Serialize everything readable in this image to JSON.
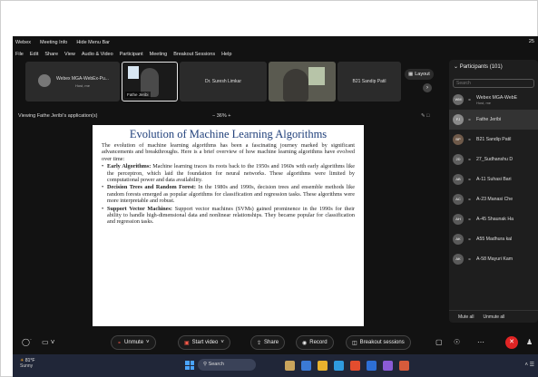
{
  "window": {
    "app_name": "Webex",
    "meeting_info": "Meeting Info",
    "hide_menu_bar": "Hide Menu Bar",
    "clock": "25"
  },
  "menu": [
    "File",
    "Edit",
    "Share",
    "View",
    "Audio & Video",
    "Participant",
    "Meeting",
    "Breakout Sessions",
    "Help"
  ],
  "strip": {
    "tile1_name": "Webex MGA-WebEx-Pu...",
    "tile1_sub": "Host, me",
    "tile2_name": "Fathe Jeribi",
    "tile3_name": "Dr. Suresh Limkar",
    "tile5_name": "B21 Sandip Patil",
    "layout_label": "Layout"
  },
  "share": {
    "viewing": "Viewing Fathe Jeribi's application(s)",
    "zoom": "36%"
  },
  "slide": {
    "title": "Evolution of Machine Learning Algorithms",
    "intro": "The evolution of machine learning algorithms has been a fascinating journey marked by significant advancements and breakthroughs. Here is a brief overview of how machine learning algorithms have evolved over time:",
    "bullets": [
      {
        "head": "Early Algorithms:",
        "text": " Machine learning traces its roots back to the 1950s and 1960s with early algorithms like the perceptron, which laid the foundation for neural networks. These algorithms were limited by computational power and data availability."
      },
      {
        "head": "Decision Trees and Random Forest:",
        "text": " In the 1980s and 1990s, decision trees and ensemble methods like random forests emerged as popular algorithms for classification and regression tasks. These algorithms were more interpretable and robust."
      },
      {
        "head": "Support Vector Machines:",
        "text": " Support vector machines (SVMs) gained prominence in the 1990s for their ability to handle high-dimensional data and nonlinear relationships. They became popular for classification and regression tasks."
      }
    ]
  },
  "participants": {
    "header": "Participants (101)",
    "search_placeholder": "Search",
    "list": [
      {
        "initials": "WM",
        "name": "Webex MGA-WebE",
        "sub": "Host, me",
        "color": "#6b6b6b"
      },
      {
        "initials": "FJ",
        "name": "Fathe Jeribi",
        "sub": "",
        "color": "#8a8a8a"
      },
      {
        "initials": "BP",
        "name": "B21 Sandip Patil",
        "sub": "",
        "color": "#6f5a4a"
      },
      {
        "initials": "2D",
        "name": "27_Sudhanshu D",
        "sub": "",
        "color": "#5f5f5f"
      },
      {
        "initials": "AB",
        "name": "A-11 Suhasi Bari",
        "sub": "",
        "color": "#5a5a5a"
      },
      {
        "initials": "AC",
        "name": "A-23 Manasi Che",
        "sub": "",
        "color": "#5a5a5a"
      },
      {
        "initials": "AH",
        "name": "A-45 Shaunak Ha",
        "sub": "",
        "color": "#5a5a5a"
      },
      {
        "initials": "AK",
        "name": "A55 Madhura kal",
        "sub": "",
        "color": "#5a5a5a"
      },
      {
        "initials": "AK",
        "name": "A-58 Mayuri Kam",
        "sub": "",
        "color": "#5a5a5a"
      }
    ],
    "mute_all": "Mute all",
    "unmute_all": "Unmute all"
  },
  "controls": {
    "unmute": "Unmute",
    "start_video": "Start video",
    "share": "Share",
    "record": "Record",
    "breakout": "Breakout sessions"
  },
  "taskbar": {
    "temperature": "81°F",
    "condition": "Sunny",
    "search": "Search"
  },
  "colors": {
    "app_bg": "#121212",
    "slide_title": "#1f3f7a",
    "end_red": "#e02424",
    "mute_red": "#ff5a4a"
  }
}
